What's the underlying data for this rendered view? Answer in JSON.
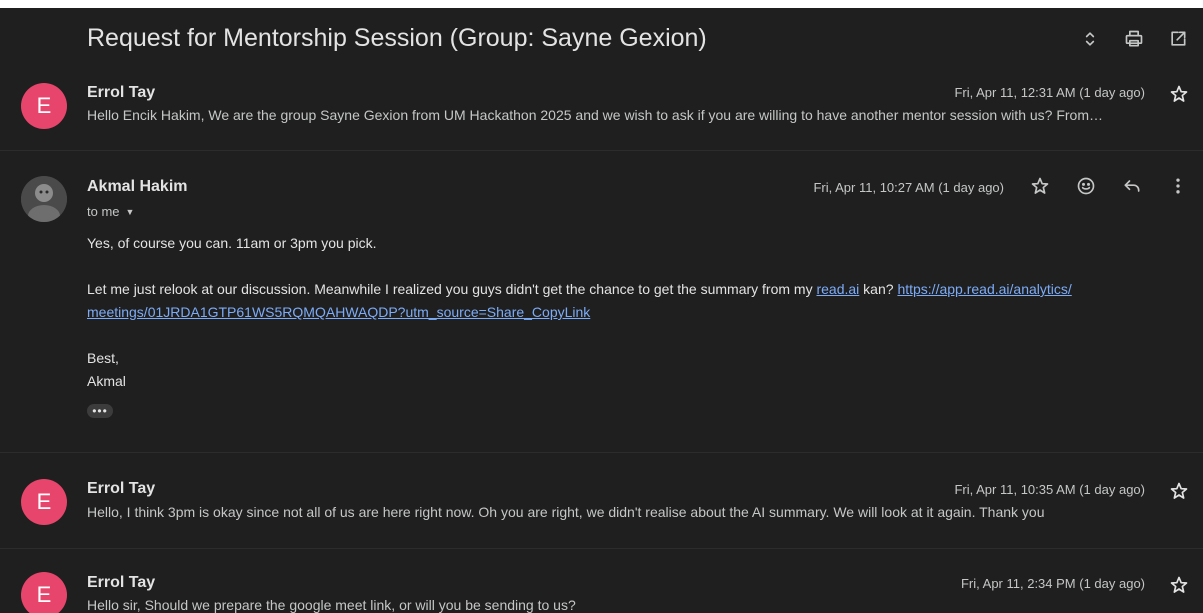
{
  "thread": {
    "subject": "Request for Mentorship Session (Group: Sayne Gexion)"
  },
  "toolbar": {
    "icons": [
      "expand-collapse-icon",
      "print-icon",
      "open-new-window-icon"
    ]
  },
  "messages": [
    {
      "avatar_letter": "E",
      "avatar_color": "#e8456c",
      "sender": "Errol Tay",
      "date": "Fri, Apr 11, 12:31 AM (1 day ago)",
      "snippet": "Hello Encik Hakim, We are the group Sayne Gexion from UM Hackathon 2025 and we wish to ask if you are willing to have another mentor session with us? From…"
    },
    {
      "sender": "Akmal Hakim",
      "date": "Fri, Apr 11, 10:27 AM (1 day ago)",
      "recipient": "to me",
      "body_line1": "Yes, of course you can. 11am or 3pm you pick.",
      "body_line2_pre": "Let me just relook at our discussion. Meanwhile I realized you guys didn't get the chance to get the summary from my ",
      "body_link1": "read.ai",
      "body_line2_mid": " kan? ",
      "body_link2_part1": "https://app.read.ai/analytics/",
      "body_link2_part2": "meetings/01JRDA1GTP61WS5RQMQAHWAQDP?utm_source=Share_CopyLink",
      "sign_off": "Best,",
      "signature": "Akmal",
      "show_trimmed": "•••"
    },
    {
      "avatar_letter": "E",
      "avatar_color": "#e8456c",
      "sender": "Errol Tay",
      "date": "Fri, Apr 11, 10:35 AM (1 day ago)",
      "snippet": "Hello, I think 3pm is okay since not all of us are here right now. Oh you are right, we didn't realise about the AI summary. We will look at it again. Thank you"
    },
    {
      "avatar_letter": "E",
      "avatar_color": "#e8456c",
      "sender": "Errol Tay",
      "date": "Fri, Apr 11, 2:34 PM (1 day ago)",
      "snippet": "Hello sir, Should we prepare the google meet link, or will you be sending to us?"
    }
  ],
  "colors": {
    "background": "#1f1f1f",
    "link": "#7cacf8",
    "avatar_pink": "#e8456c"
  }
}
